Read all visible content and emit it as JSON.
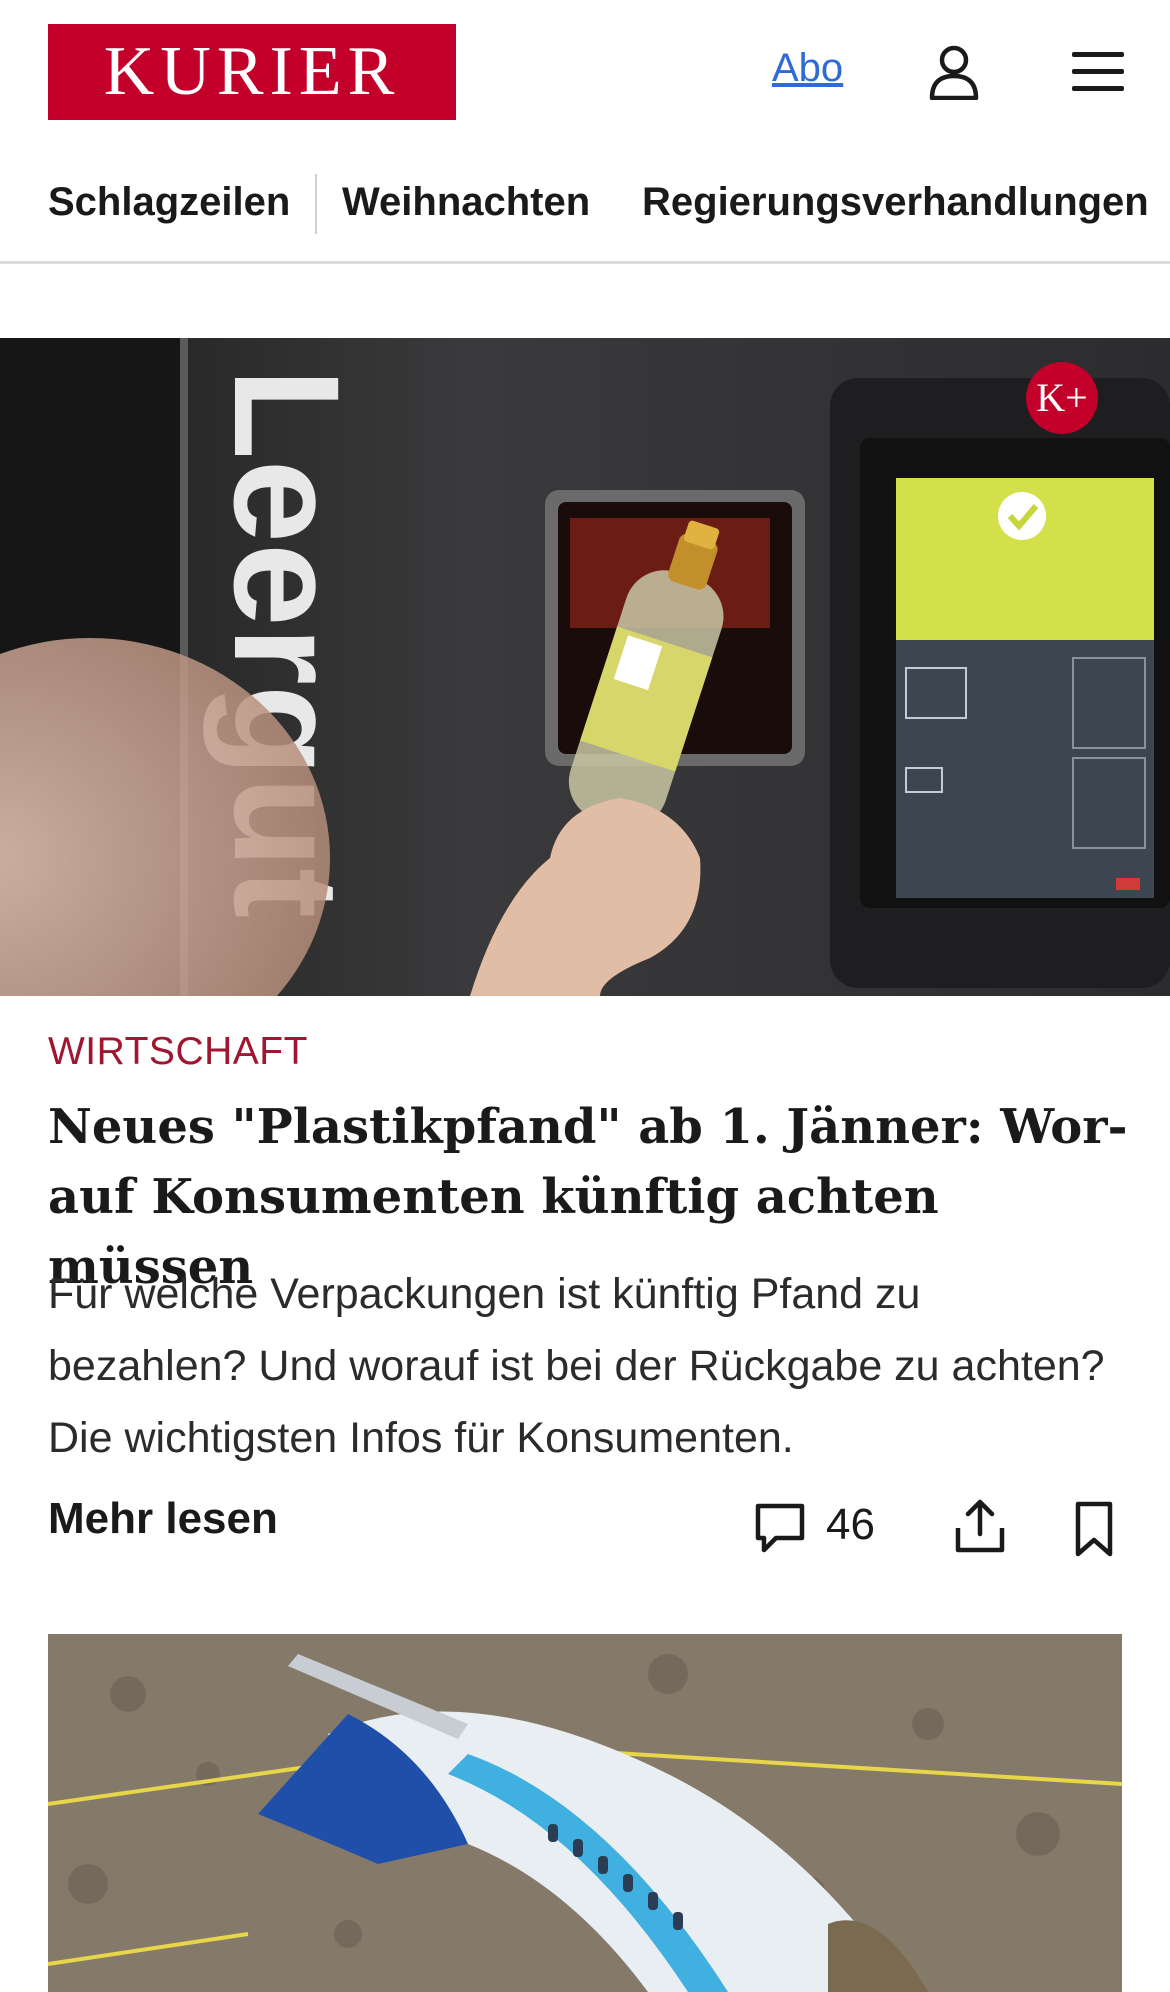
{
  "header": {
    "logo_text": "KURIER",
    "abo_label": "Abo",
    "user_icon": "user-icon",
    "menu_icon": "hamburger-menu-icon"
  },
  "nav": {
    "items": [
      "Schlagzeilen",
      "Weihnachten",
      "Regierungsverhandlungen"
    ]
  },
  "hero": {
    "premium_badge": "K+",
    "image_text": "Leergut"
  },
  "article": {
    "category": "WIRTSCHAFT",
    "headline_line1": "Neues \"Plastikpfand\" ab 1. Jänner: Wor-",
    "headline_line2": "auf Konsumenten künftig achten müssen",
    "teaser": "Für welche Verpackungen ist künftig Pfand zu bezahlen? Und worauf ist bei der Rückgabe zu achten? Die wichtigsten Infos für Konsumenten.",
    "more_label": "Mehr lesen",
    "comment_count": "46",
    "comment_icon": "comment-icon",
    "share_icon": "share-icon",
    "bookmark_icon": "bookmark-icon"
  },
  "colors": {
    "brand": "#c3002a",
    "category": "#a0152f",
    "link": "#2f6bd3"
  }
}
